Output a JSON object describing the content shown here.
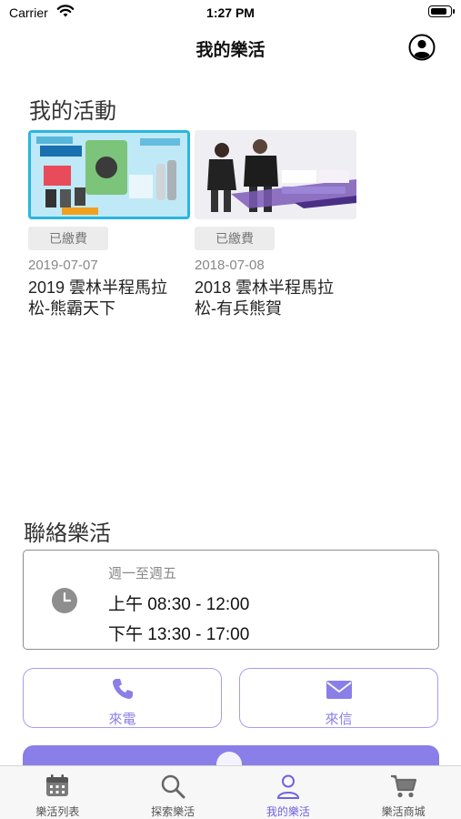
{
  "status_bar": {
    "carrier": "Carrier",
    "time": "1:27 PM",
    "battery_level": 0.85
  },
  "nav": {
    "title": "我的樂活"
  },
  "activities": {
    "title": "我的活動",
    "items": [
      {
        "badge": "已繳費",
        "date": "2019-07-07",
        "title_line1": "2019 雲林半程馬拉",
        "title_line2": "松-熊霸天下"
      },
      {
        "badge": "已繳費",
        "date": "2018-07-08",
        "title_line1": "2018 雲林半程馬拉",
        "title_line2": "松-有兵熊賀"
      }
    ]
  },
  "contact": {
    "title": "聯絡樂活",
    "days": "週一至週五",
    "morning": "上午 08:30 - 12:00",
    "afternoon": "下午 13:30 - 17:00",
    "call_label": "來電",
    "mail_label": "來信"
  },
  "tabs": [
    {
      "label": "樂活列表",
      "icon": "calendar-icon",
      "active": false
    },
    {
      "label": "探索樂活",
      "icon": "search-icon",
      "active": false
    },
    {
      "label": "我的樂活",
      "icon": "person-icon",
      "active": true
    },
    {
      "label": "樂活商城",
      "icon": "cart-icon",
      "active": false
    }
  ],
  "colors": {
    "accent": "#8a7fe8",
    "active_tab": "#6f63e0",
    "badge_bg": "#ececec"
  }
}
